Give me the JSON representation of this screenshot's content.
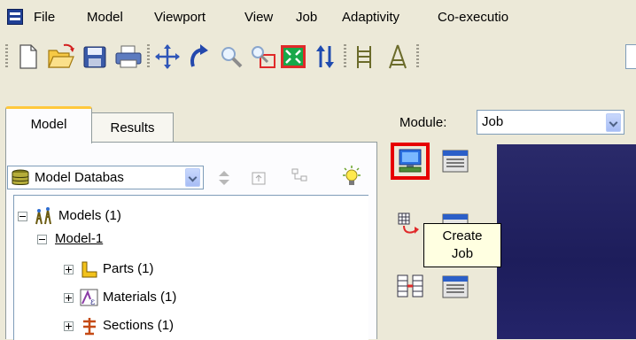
{
  "menu": {
    "items": [
      "File",
      "Model",
      "Viewport",
      "View",
      "Job",
      "Adaptivity",
      "Co-executio"
    ]
  },
  "toolbar": {
    "icons": [
      "new-icon",
      "open-icon",
      "save-icon",
      "print-icon",
      "pan-icon",
      "rotate-icon",
      "zoom-icon",
      "box-zoom-icon",
      "auto-fit-icon",
      "cycle-views-icon",
      "mesh-icon",
      "partition-icon"
    ]
  },
  "tabs": {
    "model": "Model",
    "results": "Results"
  },
  "model_tree": {
    "combo_value": "Model Databas",
    "items": [
      {
        "label": "Models (1)",
        "expander": "minus"
      },
      {
        "label": "Model-1",
        "expander": "minus"
      },
      {
        "label": "Parts (1)",
        "expander": "plus"
      },
      {
        "label": "Materials (1)",
        "expander": "plus"
      },
      {
        "label": "Sections (1)",
        "expander": "plus"
      }
    ]
  },
  "module": {
    "label": "Module:",
    "value": "Job"
  },
  "tooltip": {
    "line1": "Create",
    "line2": "Job"
  },
  "colors": {
    "highlight": "#e60000",
    "viewport": "#1f1f5f",
    "tab_accent": "#ffc83c",
    "tooltip_bg": "#ffffe1"
  }
}
